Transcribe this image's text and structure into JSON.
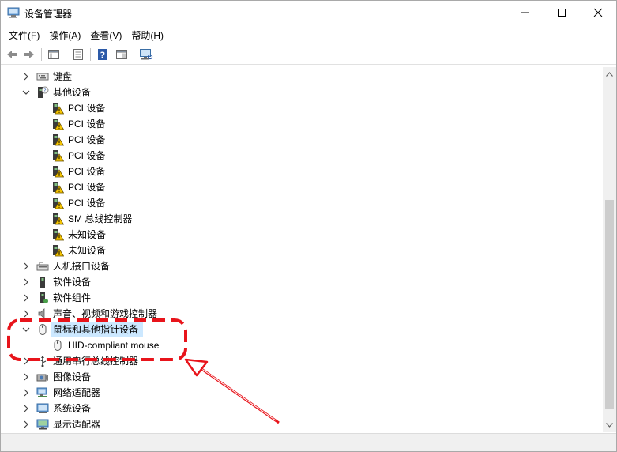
{
  "window": {
    "title": "设备管理器"
  },
  "menu": [
    {
      "label": "文件(F)"
    },
    {
      "label": "操作(A)"
    },
    {
      "label": "查看(V)"
    },
    {
      "label": "帮助(H)"
    }
  ],
  "tree": [
    {
      "label": "键盘",
      "level": 0,
      "expanded": false,
      "icon": "keyboard-icon"
    },
    {
      "label": "其他设备",
      "level": 0,
      "expanded": true,
      "icon": "unknown-device-icon"
    },
    {
      "label": "PCI 设备",
      "level": 1,
      "icon": "warning-device-icon"
    },
    {
      "label": "PCI 设备",
      "level": 1,
      "icon": "warning-device-icon"
    },
    {
      "label": "PCI 设备",
      "level": 1,
      "icon": "warning-device-icon"
    },
    {
      "label": "PCI 设备",
      "level": 1,
      "icon": "warning-device-icon"
    },
    {
      "label": "PCI 设备",
      "level": 1,
      "icon": "warning-device-icon"
    },
    {
      "label": "PCI 设备",
      "level": 1,
      "icon": "warning-device-icon"
    },
    {
      "label": "PCI 设备",
      "level": 1,
      "icon": "warning-device-icon"
    },
    {
      "label": "SM 总线控制器",
      "level": 1,
      "icon": "warning-device-icon"
    },
    {
      "label": "未知设备",
      "level": 1,
      "icon": "warning-device-icon"
    },
    {
      "label": "未知设备",
      "level": 1,
      "icon": "warning-device-icon"
    },
    {
      "label": "人机接口设备",
      "level": 0,
      "expanded": false,
      "icon": "hid-icon"
    },
    {
      "label": "软件设备",
      "level": 0,
      "expanded": false,
      "icon": "software-device-icon"
    },
    {
      "label": "软件组件",
      "level": 0,
      "expanded": false,
      "icon": "software-component-icon"
    },
    {
      "label": "声音、视频和游戏控制器",
      "level": 0,
      "expanded": false,
      "icon": "speaker-icon"
    },
    {
      "label": "鼠标和其他指针设备",
      "level": 0,
      "expanded": true,
      "selected": true,
      "icon": "mouse-icon"
    },
    {
      "label": "HID-compliant mouse",
      "level": 1,
      "icon": "mouse-icon"
    },
    {
      "label": "通用串行总线控制器",
      "level": 0,
      "expanded": false,
      "icon": "usb-icon"
    },
    {
      "label": "图像设备",
      "level": 0,
      "expanded": false,
      "icon": "camera-icon"
    },
    {
      "label": "网络适配器",
      "level": 0,
      "expanded": false,
      "icon": "network-icon"
    },
    {
      "label": "系统设备",
      "level": 0,
      "expanded": false,
      "icon": "system-device-icon"
    },
    {
      "label": "显示适配器",
      "level": 0,
      "expanded": false,
      "icon": "display-adapter-icon"
    }
  ],
  "colors": {
    "selection": "#cce8ff",
    "annotation": "#e8141b"
  }
}
